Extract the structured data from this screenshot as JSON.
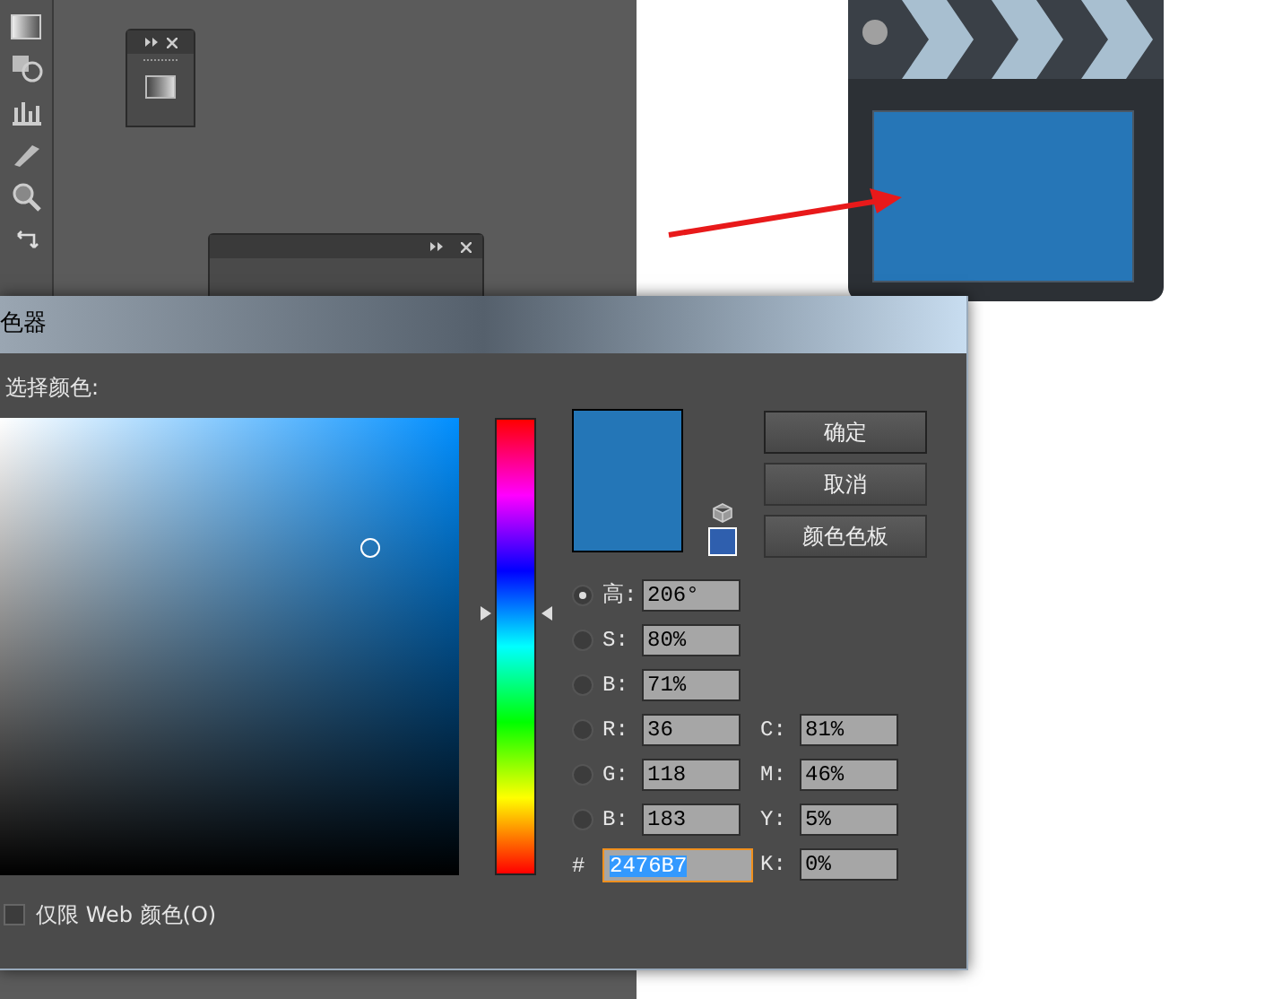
{
  "dialog": {
    "title": "色器",
    "prompt": "选择颜色:",
    "buttons": [
      "确定",
      "取消",
      "颜色色板"
    ],
    "hsb_rgb_fields": [
      {
        "label": "高:",
        "value": "206°",
        "selected": true
      },
      {
        "label": "S:",
        "value": "80%",
        "selected": false
      },
      {
        "label": "B:",
        "value": "71%",
        "selected": false
      },
      {
        "label": "R:",
        "value": "36",
        "selected": false
      },
      {
        "label": "G:",
        "value": "118",
        "selected": false
      },
      {
        "label": "B:",
        "value": "183",
        "selected": false
      }
    ],
    "cmyk_fields": [
      {
        "label": "C:",
        "value": "81%"
      },
      {
        "label": "M:",
        "value": "46%"
      },
      {
        "label": "Y:",
        "value": "5%"
      },
      {
        "label": "K:",
        "value": "0%"
      }
    ],
    "hex_field": {
      "label": "#",
      "value": "2476B7",
      "focused": true
    },
    "web_only": {
      "label": "仅限 Web 颜色(O)",
      "checked": false
    }
  }
}
